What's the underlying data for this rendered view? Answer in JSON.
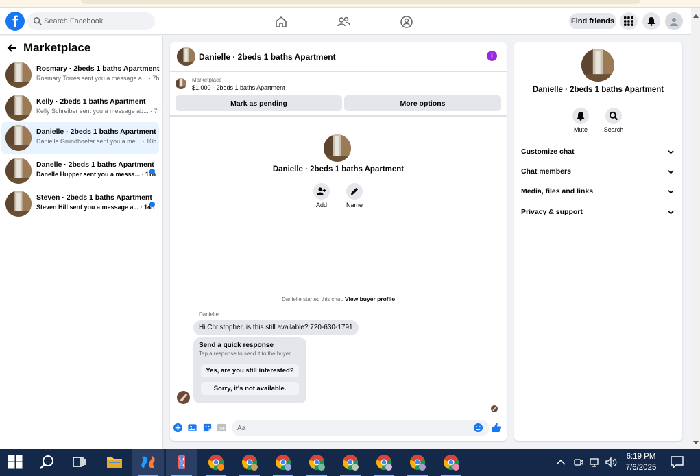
{
  "topnav": {
    "search_placeholder": "Search Facebook",
    "find_friends_label": "Find friends",
    "logo_letter": "f"
  },
  "sidebar": {
    "title": "Marketplace",
    "conversations": [
      {
        "title": "Rosmary · 2beds 1 baths Apartment",
        "preview": "Rosmary Torres sent you a message a... · 7h",
        "unread": false,
        "active": false
      },
      {
        "title": "Kelly · 2beds 1 baths Apartment",
        "preview": "Kelly Schreiber sent you a message ab... · 7h",
        "unread": false,
        "active": false
      },
      {
        "title": "Danielle · 2beds 1 baths Apartment",
        "preview": "Danielle Grundhoefer sent you a me... · 10h",
        "unread": false,
        "active": true
      },
      {
        "title": "Danelle · 2beds 1 baths Apartment",
        "preview": "Danelle Hupper sent you a messa... · 11h",
        "unread": true,
        "active": false
      },
      {
        "title": "Steven · 2beds 1 baths Apartment",
        "preview": "Steven Hill sent you a message a... · 14h",
        "unread": true,
        "active": false
      }
    ]
  },
  "chat": {
    "header_title": "Danielle · 2beds 1 baths Apartment",
    "info_glyph": "i",
    "listing_label": "Marketplace",
    "listing_price": "$1,000 - 2beds 1 baths Apartment",
    "mark_pending_label": "Mark as pending",
    "more_options_label": "More options",
    "profile_name": "Danielle · 2beds 1 baths Apartment",
    "add_label": "Add",
    "name_label": "Name",
    "started_text": "Danielle started this chat.",
    "view_buyer_label": "View buyer profile",
    "sender_name": "Danielle",
    "message_text": "Hi Christopher, is this still available? 720-630-1791",
    "quick_title": "Send a quick response",
    "quick_subtitle": "Tap a response to send it to the buyer.",
    "quick_reply_1": "Yes, are you still interested?",
    "quick_reply_2": "Sorry, it's not available.",
    "input_placeholder": "Aa",
    "gif_label": "GIF"
  },
  "details": {
    "name": "Danielle · 2beds 1 baths Apartment",
    "mute_label": "Mute",
    "search_label": "Search",
    "sections": [
      "Customize chat",
      "Chat members",
      "Media, files and links",
      "Privacy & support"
    ]
  },
  "taskbar": {
    "time": "6:19 PM",
    "date": "7/6/2025"
  },
  "colors": {
    "brand_blue": "#1877f2",
    "active_conv_bg": "#e7f3ff",
    "info_purple": "#9b28e0",
    "taskbar_bg": "#14284a"
  }
}
